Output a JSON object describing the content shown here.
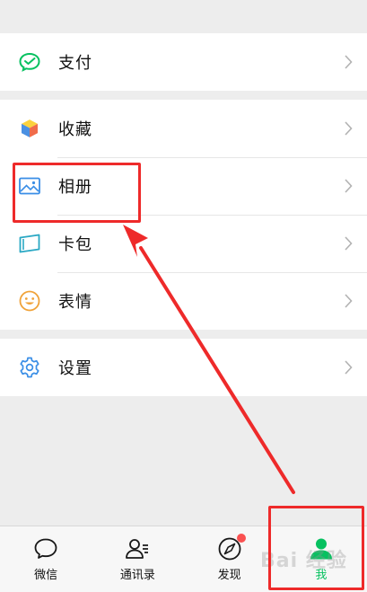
{
  "menu": {
    "items": [
      {
        "key": "pay",
        "label": "支付",
        "icon": "wechat-pay-icon"
      },
      {
        "key": "favorites",
        "label": "收藏",
        "icon": "favorites-cube-icon"
      },
      {
        "key": "album",
        "label": "相册",
        "icon": "album-picture-icon"
      },
      {
        "key": "cards",
        "label": "卡包",
        "icon": "card-wallet-icon"
      },
      {
        "key": "stickers",
        "label": "表情",
        "icon": "smiley-icon"
      },
      {
        "key": "settings",
        "label": "设置",
        "icon": "gear-icon"
      }
    ]
  },
  "tabbar": {
    "tabs": [
      {
        "key": "chats",
        "label": "微信",
        "icon": "chat-bubble-icon"
      },
      {
        "key": "contacts",
        "label": "通讯录",
        "icon": "contacts-icon"
      },
      {
        "key": "discover",
        "label": "发现",
        "icon": "compass-icon",
        "badge": true
      },
      {
        "key": "me",
        "label": "我",
        "icon": "person-icon",
        "active": true
      }
    ]
  },
  "colors": {
    "brand_green": "#07c160",
    "annotation_red": "#ee2a2a",
    "badge_red": "#fa5151"
  },
  "watermark": {
    "text": "Bai 经验"
  }
}
